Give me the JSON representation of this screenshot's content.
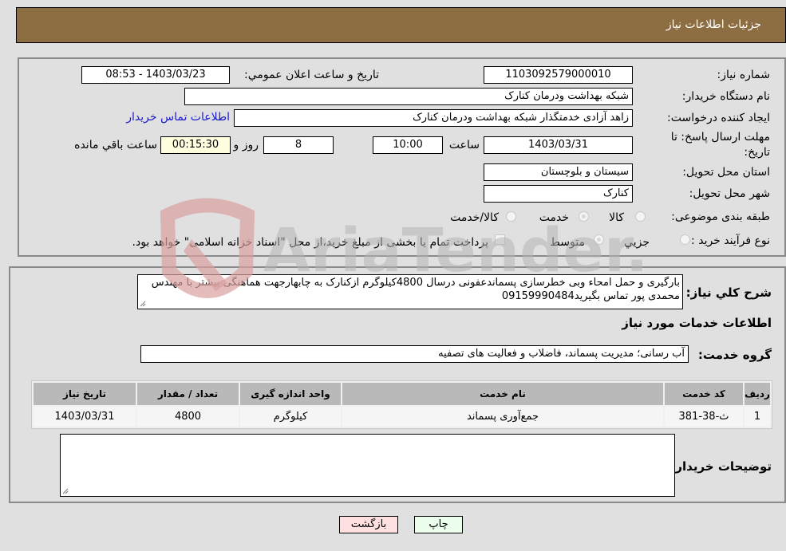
{
  "header": {
    "title": "جزئيات اطلاعات نياز"
  },
  "fields": {
    "need_number": {
      "label": "شماره نیاز:",
      "value": "1103092579000010"
    },
    "announce_datetime": {
      "label": "تاريخ و ساعت اعلان عمومي:",
      "value": "1403/03/23 - 08:53"
    },
    "buyer_org": {
      "label": "نام دستگاه خریدار:",
      "value": "شبکه بهداشت ودرمان کنارک"
    },
    "requester": {
      "label": "ایجاد کننده درخواست:",
      "value": "زاهد  آزادی خدمتگذار شبکه بهداشت ودرمان کنارک"
    },
    "buyer_contact_link": "اطلاعات تماس خریدار",
    "deadline": {
      "label": "مهلت ارسال پاسخ: تا تاریخ:",
      "date": "1403/03/31",
      "time_label": "ساعت",
      "time": "10:00",
      "days": "8",
      "days_label": "روز و",
      "remaining": "00:15:30",
      "remaining_label": "ساعت باقي مانده"
    },
    "province": {
      "label": "استان محل تحویل:",
      "value": "سیستان و بلوچستان"
    },
    "city": {
      "label": "شهر محل تحویل:",
      "value": "کنارک"
    },
    "category": {
      "label": "طبقه بندی موضوعی:",
      "options": [
        {
          "label": "کالا",
          "checked": false
        },
        {
          "label": "خدمت",
          "checked": true
        },
        {
          "label": "کالا/خدمت",
          "checked": false
        }
      ]
    },
    "purchase_type": {
      "label": "نوع فرآیند خرید :",
      "options": [
        {
          "label": "جزيي",
          "checked": false
        },
        {
          "label": "متوسط",
          "checked": true
        }
      ],
      "treasury_note": "پرداخت تمام یا بخشی از مبلغ خرید،از محل \"اسناد خزانه اسلامی\" خواهد بود."
    }
  },
  "description": {
    "label": "شرح کلي نياز:",
    "text": "بارگیری و حمل امحاء وبی خطرسازی پسماندعفونی درسال 4800کیلوگرم ازکنارک به چابهارجهت هماهنگی بیشتر با مهندس محمدی پور تماس بگیرید09159990484"
  },
  "services_section": {
    "title": "اطلاعات خدمات مورد نياز",
    "group_label": "گروه خدمت:",
    "group_value": "آب رسانی؛ مدیریت پسماند، فاضلاب و فعالیت های تصفیه"
  },
  "table": {
    "headers": [
      "رديف",
      "کد خدمت",
      "نام خدمت",
      "واحد اندازه گيری",
      "تعداد / مقدار",
      "تاریخ نیاز"
    ],
    "rows": [
      [
        "1",
        "ث-38-381",
        "جمع‌آوری پسماند",
        "کیلوگرم",
        "4800",
        "1403/03/31"
      ]
    ]
  },
  "buyer_notes": {
    "label": "توضیحات خریدار:",
    "value": ""
  },
  "buttons": {
    "print": "چاپ",
    "back": "بازگشت"
  },
  "watermark": {
    "text": "AriaTender.neT"
  }
}
